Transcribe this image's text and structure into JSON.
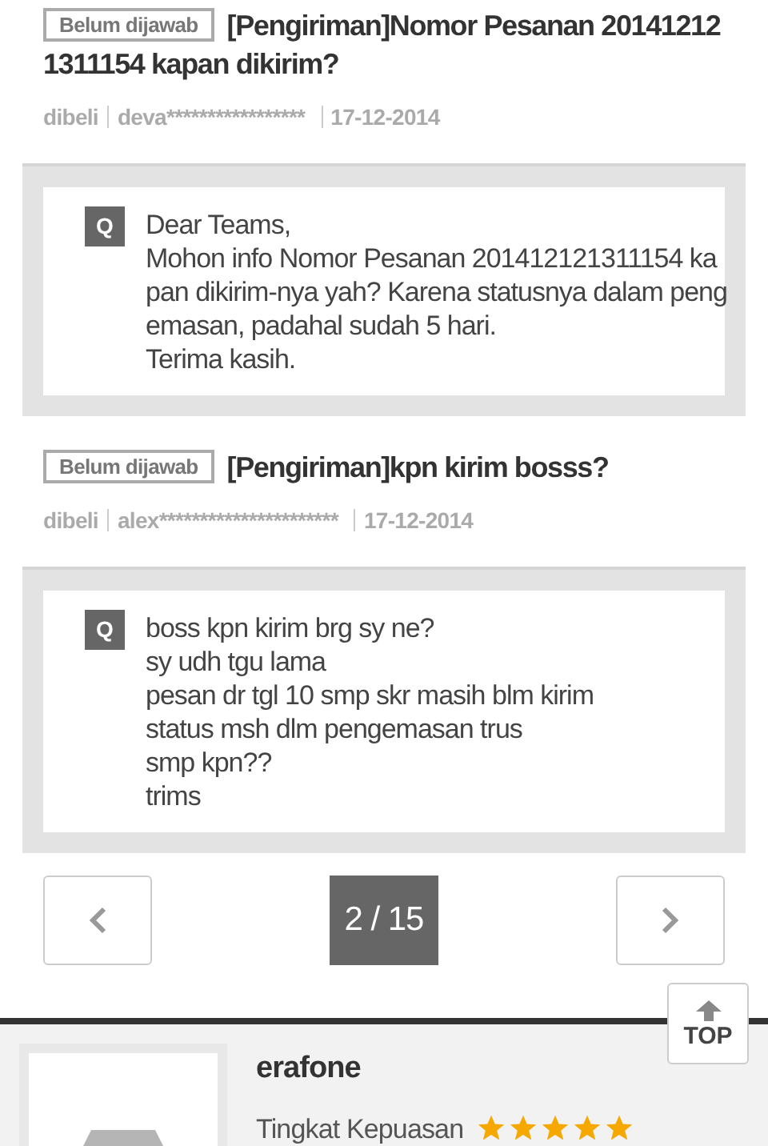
{
  "questions": [
    {
      "status": "Belum dijawab",
      "title_lines": [
        "[Pengiriman]Nomor Pesanan 20141212",
        "1311154 kapan dikirim?"
      ],
      "tag": "dibeli",
      "user": "deva*****************",
      "date": "17-12-2014",
      "marker": "Q",
      "lines": [
        "Dear Teams,",
        "Mohon info Nomor Pesanan 201412121311154 ka",
        "pan dikirim-nya yah? Karena statusnya dalam peng",
        "emasan, padahal sudah 5 hari.",
        "Terima kasih."
      ]
    },
    {
      "status": "Belum dijawab",
      "title_lines": [
        "[Pengiriman]kpn kirim bosss?"
      ],
      "tag": "dibeli",
      "user": "alex**********************",
      "date": "17-12-2014",
      "marker": "Q",
      "lines": [
        "boss kpn kirim brg sy ne?",
        "sy udh tgu lama",
        "pesan dr tgl 10 smp skr masih blm kirim",
        "status msh dlm pengemasan trus",
        "smp kpn??",
        "trims"
      ]
    }
  ],
  "pager": {
    "page": "2 / 15"
  },
  "top_button": {
    "label": "TOP"
  },
  "seller": {
    "name": "erafone",
    "rating_label": "Tingkat Kepuasan",
    "stars": 5
  }
}
